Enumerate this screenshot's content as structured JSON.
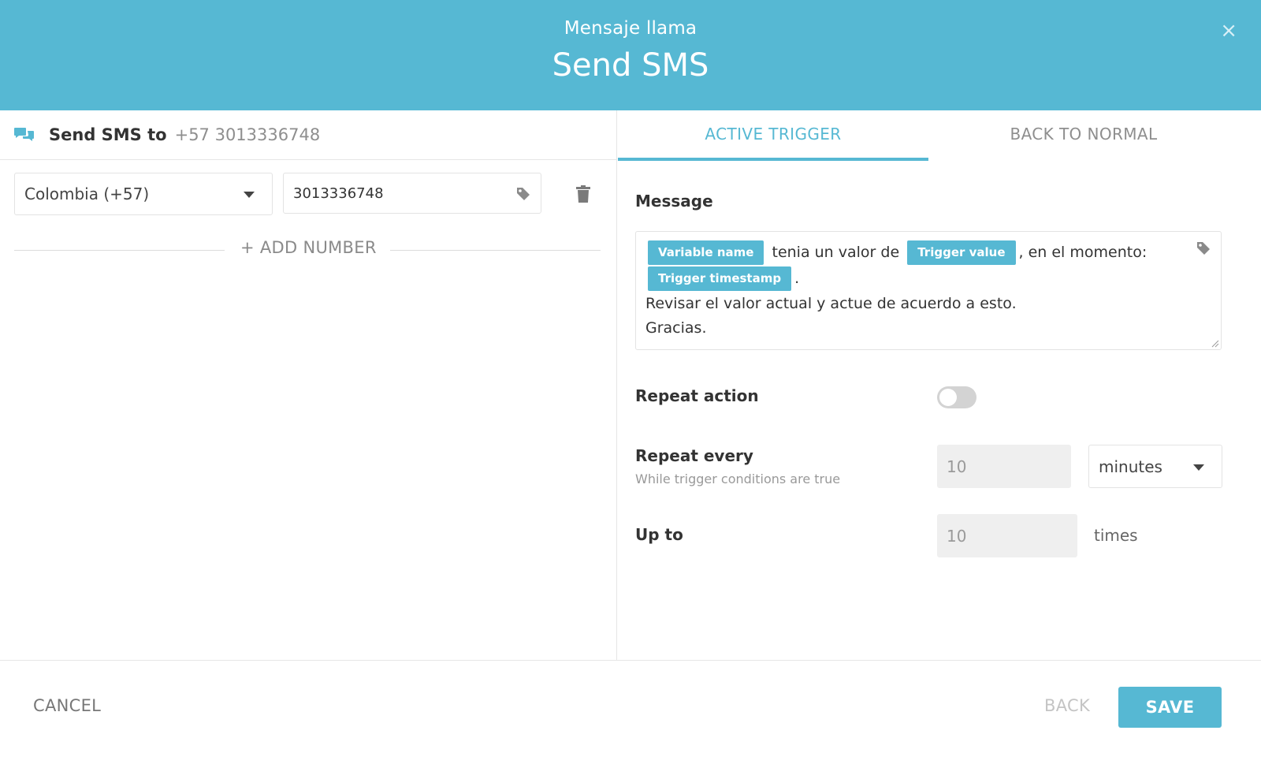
{
  "header": {
    "subtitle": "Mensaje llama",
    "title": "Send SMS",
    "close_glyph": "×"
  },
  "send_to": {
    "icon": "sms-chat-icon",
    "label": "Send SMS to",
    "number": "+57 3013336748"
  },
  "phone_entry": {
    "country": "Colombia (+57)",
    "number": "3013336748",
    "add_number_label": "+ ADD NUMBER"
  },
  "tabs": [
    {
      "label": "ACTIVE TRIGGER",
      "active": true
    },
    {
      "label": "BACK TO NORMAL",
      "active": false
    }
  ],
  "message": {
    "label": "Message",
    "chip_variable_name": "Variable name",
    "text_1": "tenia un valor de",
    "chip_trigger_value": "Trigger value",
    "text_2": ", en el momento:",
    "chip_trigger_timestamp": "Trigger timestamp",
    "text_3": ".",
    "line_2": "Revisar el valor actual y actue de acuerdo a esto.",
    "line_3": "Gracias."
  },
  "repeat_action": {
    "label": "Repeat action",
    "enabled": false
  },
  "repeat_every": {
    "label": "Repeat every",
    "hint": "While trigger conditions are true",
    "value": "10",
    "unit": "minutes"
  },
  "up_to": {
    "label": "Up to",
    "value": "10",
    "suffix": "times"
  },
  "footer": {
    "cancel": "CANCEL",
    "back": "BACK",
    "save": "SAVE"
  },
  "colors": {
    "accent": "#56b8d3",
    "toggle_off": "#d3d3d3"
  }
}
